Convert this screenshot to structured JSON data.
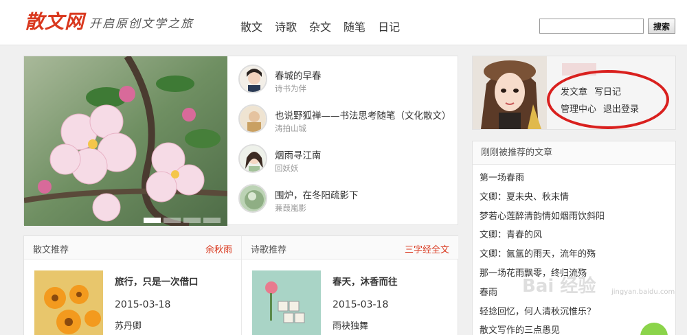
{
  "header": {
    "logo": "散文网",
    "slogan": "开启原创文学之旅",
    "nav": [
      "散文",
      "诗歌",
      "杂文",
      "随笔",
      "日记"
    ],
    "search_button": "搜索"
  },
  "slider": {
    "articles": [
      {
        "title": "春城的早春",
        "author": "诗书为伴"
      },
      {
        "title": "也说野狐禅——书法思考随笔（文化散文）",
        "author": "涛拍山城"
      },
      {
        "title": "烟雨寻江南",
        "author": "回妖妖"
      },
      {
        "title": "围炉，在冬阳疏影下",
        "author": "蒹葭嵐影"
      }
    ]
  },
  "profile": {
    "links": [
      "发文章",
      "写日记",
      "管理中心",
      "退出登录"
    ]
  },
  "recommended": {
    "header": "刚刚被推荐的文章",
    "items": [
      "第一场春雨",
      "文卿：夏未央、秋末情",
      "梦若心莲醉清韵情如烟雨饮斜阳",
      "文卿：青春的风",
      "文卿：氤氲的雨天，流年的殇",
      "那一场花雨飘零，终归流殇",
      "春雨",
      "轻捻回忆，何人清秋沉惟乐？",
      "散文写作的三点愚见"
    ]
  },
  "bottom": {
    "left": {
      "title": "散文推荐",
      "featured_author": "余秋雨",
      "article_title": "旅行，只是一次借口",
      "date": "2015-03-18",
      "author": "苏丹卿"
    },
    "right": {
      "title": "诗歌推荐",
      "featured_author": "三字经全文",
      "article_title": "春天，沐香而往",
      "date": "2015-03-18",
      "author": "雨袂独舞"
    }
  },
  "watermark": {
    "text": "Bai 经验",
    "sub": "jingyan.baidu.com"
  },
  "colors": {
    "brand": "#d9381e",
    "highlight": "#d9201e"
  }
}
